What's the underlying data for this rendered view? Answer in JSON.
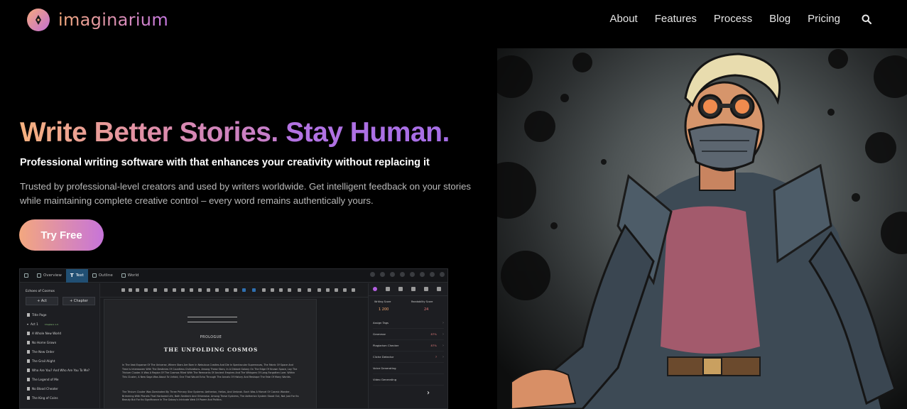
{
  "brand": {
    "name": "imaginarium"
  },
  "nav": {
    "items": [
      "About",
      "Features",
      "Process",
      "Blog",
      "Pricing"
    ],
    "search_icon": "search-icon"
  },
  "hero": {
    "headline_part1": "Write Better Stories.",
    "headline_part2": "Stay Human.",
    "subheadline": "Professional writing software with that enhances your creativity without replacing it",
    "description": "Trusted by professional-level creators and used by writers worldwide. Get intelligent feedback on your stories while maintaining complete creative control – every word remains authentically yours.",
    "cta_label": "Try Free",
    "art_description_icon": "character-illustration"
  },
  "app": {
    "tabs": [
      "Overview",
      "Text",
      "Outline",
      "World"
    ],
    "active_tab": "Text",
    "left_panel": {
      "title": "Echoes of Cosmos",
      "add_act": "+  Act",
      "add_chapter": "+  Chapter",
      "items": [
        {
          "label": "Title Page",
          "note": ""
        },
        {
          "label": "Act 1",
          "note": "Chapters 1-5"
        },
        {
          "label": "A Whole New World",
          "note": "Scene 1"
        },
        {
          "label": "No Home Grown",
          "note": "Scene 2"
        },
        {
          "label": "The New Order",
          "note": "Scene 3"
        },
        {
          "label": "The Grail Alight",
          "note": "Scene 4"
        },
        {
          "label": "Who Are You? And Who Are You To Me?",
          "note": "Scene 5"
        },
        {
          "label": "The Legend of Me",
          "note": "Scene 6"
        },
        {
          "label": "No Blood Cheater",
          "note": "Scene 7"
        },
        {
          "label": "The King of Coins",
          "note": "Scene 8"
        }
      ]
    },
    "document": {
      "section": "PROLOGUE",
      "title": "THE UNFOLDING COSMOS",
      "paragraph1": "In The Vast Expanse Of The Universe, Where Stars Are Born In Nebulous Cradles And Die In Spectacular Supernovas, The Fabric Of Space And Time Is Interwoven With The Destinies Of Countless Civilizations. Among These Stars, In A Distant Galaxy On The Edge Of Known Space, Lay The Trivium Cluster. It Was A Region Of The Cosmos Filled With The Remnants Of Ancient Empires And The Whispers Of Long-Forgotten Lore. Within This Cluster, A New Saga Was About To Unfold, One That Would Echo Through The Annals Of History And Reshape The Fate Of Many Worlds.",
      "paragraph2": "The Trivium Cluster Was Dominated By Three Primary Star Systems: Aetherion, Helios, And Umbrak. Each Was A Marvel Of Cosmic Wonder, Brimming With Planets That Harbored Life, Both Sentient And Otherwise. Among These Systems, The Aetherion System Stood Out, Not Just For Its Beauty But For Its Significance In The Galaxy's Intricate Web Of Power And Politics."
    },
    "right_panel": {
      "writing_score_label": "Writing Score",
      "writing_score_value": "1 200",
      "readability_label": "Readability Score",
      "readability_value": "24",
      "rows": [
        {
          "label": "Assign Tags",
          "pct": ""
        },
        {
          "label": "Grammar",
          "pct": "87%"
        },
        {
          "label": "Plagiarism Checker",
          "pct": "87%"
        },
        {
          "label": "Cliche Detector",
          "pct": "?"
        },
        {
          "label": "Voice Generating",
          "pct": ""
        },
        {
          "label": "Video Generating",
          "pct": ""
        }
      ]
    }
  },
  "colors": {
    "gradient_start": "#f3a77f",
    "gradient_end": "#c774d9",
    "purple": "#a56de6",
    "background": "#000000"
  }
}
